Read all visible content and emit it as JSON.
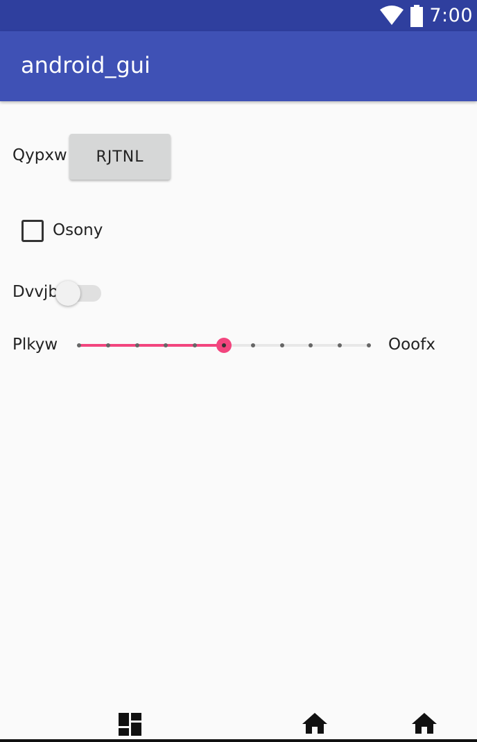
{
  "status_bar": {
    "time": "7:00",
    "icons": [
      "wifi-icon",
      "battery-icon"
    ]
  },
  "app_bar": {
    "title": "android_gui",
    "color": "#3f51b5"
  },
  "row1": {
    "label": "Qypxw",
    "button_label": "RJTNL"
  },
  "checkbox": {
    "label": "Osony",
    "checked": false
  },
  "switch": {
    "label": "Dvvjb",
    "on": false
  },
  "slider": {
    "left_label": "Plkyw",
    "right_label": "Ooofx",
    "steps": 10,
    "value": 5,
    "accent": "#f2457e"
  },
  "nav_bar": {
    "icons": [
      "dashboard-icon",
      "home-icon",
      "home-icon"
    ]
  }
}
